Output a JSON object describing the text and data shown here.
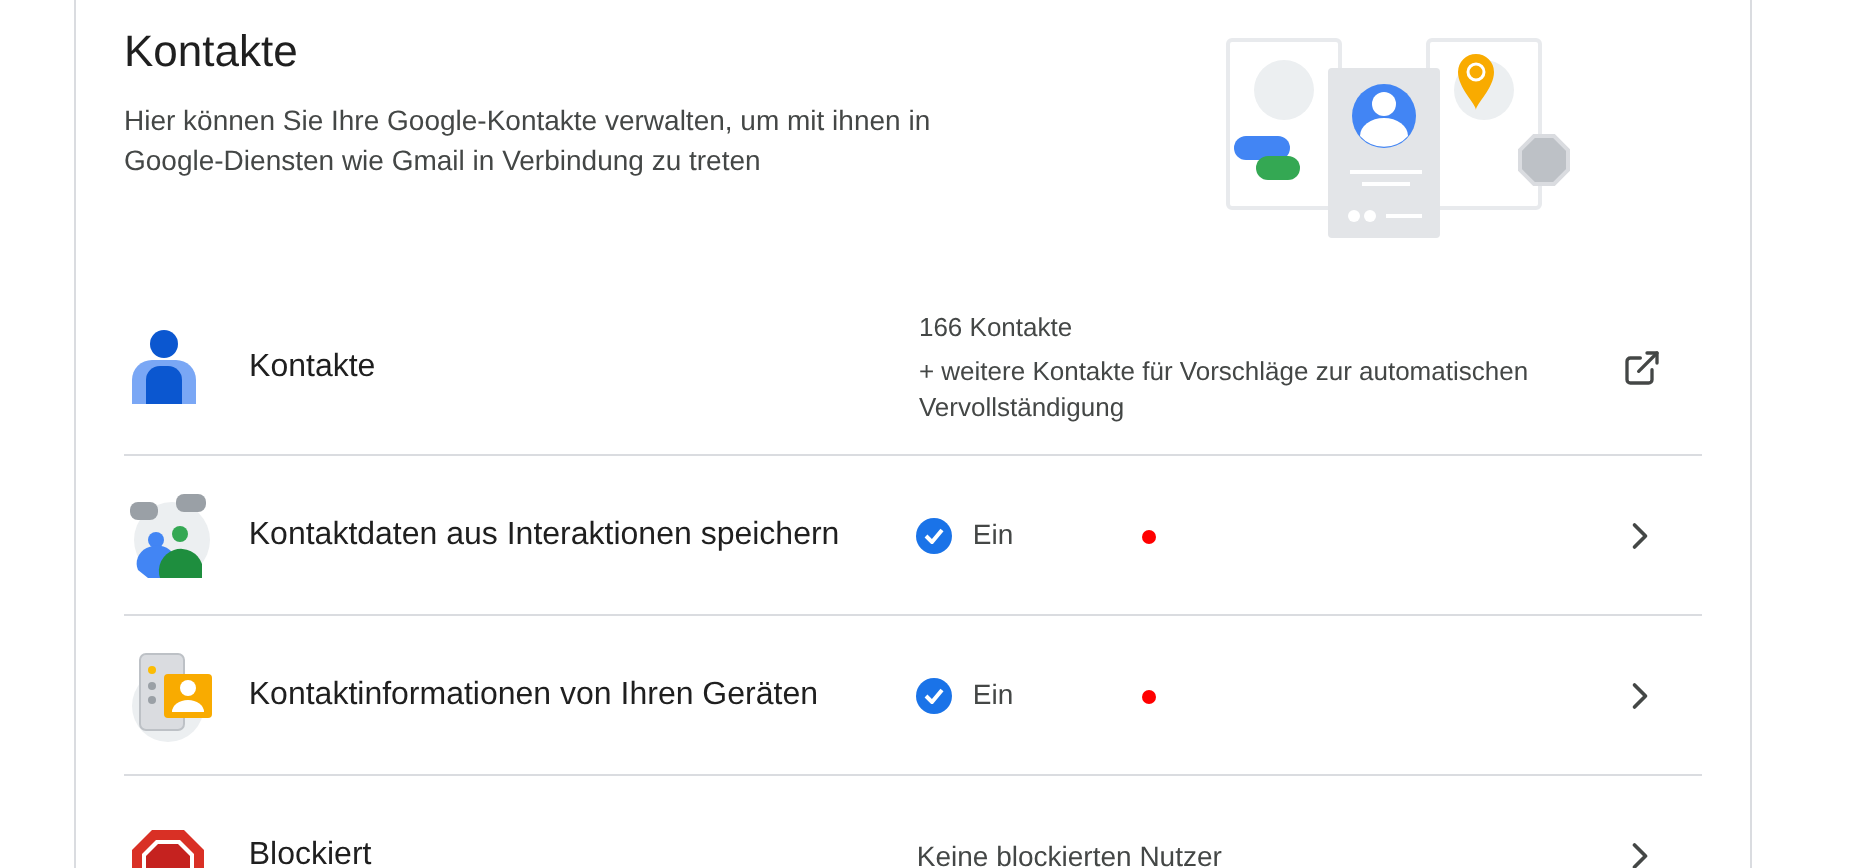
{
  "header": {
    "title": "Kontakte",
    "description": "Hier können Sie Ihre Google-Kontakte verwalten, um mit ihnen in Google-Diensten wie Gmail in Verbindung zu treten"
  },
  "rows": [
    {
      "kind": "contacts",
      "label": "Kontakte",
      "status_lines": [
        "166 Kontakte",
        "+ weitere Kontakte für Vorschläge zur automatischen Vervollständigung"
      ],
      "marked": false
    },
    {
      "kind": "interactions",
      "label": "Kontaktdaten aus Interaktionen speichern",
      "checked": true,
      "status": "Ein",
      "marked": true
    },
    {
      "kind": "devices",
      "label": "Kontaktinformationen von Ihren Geräten",
      "checked": true,
      "status": "Ein",
      "marked": true
    },
    {
      "kind": "blocked",
      "label": "Blockiert",
      "status": "Keine blockierten Nutzer",
      "marked": false
    }
  ]
}
